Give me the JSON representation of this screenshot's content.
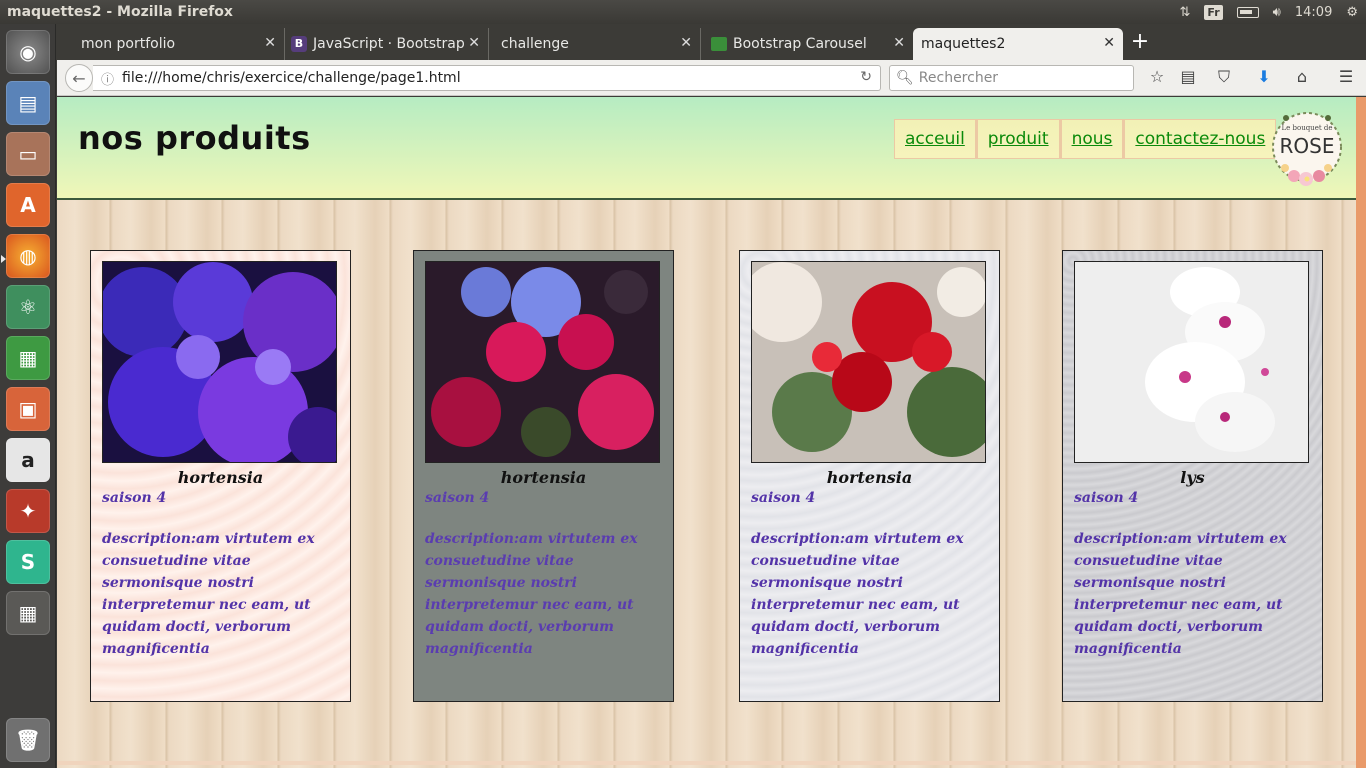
{
  "window": {
    "title": "maquettes2 - Mozilla Firefox"
  },
  "tray": {
    "lang": "Fr",
    "time": "14:09"
  },
  "tabs": [
    {
      "label": "mon portfolio"
    },
    {
      "label": "JavaScript · Bootstrap"
    },
    {
      "label": "challenge"
    },
    {
      "label": "Bootstrap Carousel"
    },
    {
      "label": "maquettes2"
    }
  ],
  "nav": {
    "url": "file:///home/chris/exercice/challenge/page1.html",
    "search_placeholder": "Rechercher"
  },
  "page": {
    "title": "nos produits",
    "menu": [
      "acceuil",
      "produit",
      "nous",
      "contactez-nous"
    ],
    "logo": {
      "top": "Le bouquet de",
      "main": "ROSE"
    },
    "cards": [
      {
        "name": "hortensia",
        "season": "saison 4",
        "desc": "description:am virtutem ex consuetudine vitae sermonisque nostri interpretemur nec eam, ut quidam docti, verborum magnificentia"
      },
      {
        "name": "hortensia",
        "season": "saison 4",
        "desc": "description:am virtutem ex consuetudine vitae sermonisque nostri interpretemur nec eam, ut quidam docti, verborum magnificentia"
      },
      {
        "name": "hortensia",
        "season": "saison 4",
        "desc": "description:am virtutem ex consuetudine vitae sermonisque nostri interpretemur nec eam, ut quidam docti, verborum magnificentia"
      },
      {
        "name": "lys",
        "season": "saison 4",
        "desc": "description:am virtutem ex consuetudine vitae sermonisque nostri interpretemur nec eam, ut quidam docti, verborum magnificentia"
      }
    ]
  },
  "colors": {
    "accent_text": "#5333a8",
    "link": "#0a8a0a",
    "header_top": "#b6ecc2",
    "header_bottom": "#f0f7b8"
  }
}
